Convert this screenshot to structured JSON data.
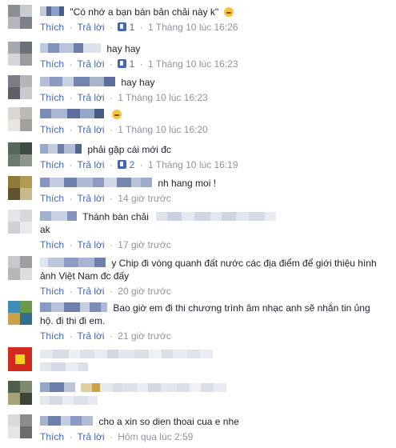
{
  "labels": {
    "like": "Thích",
    "reply": "Trả lời",
    "sep": "·"
  },
  "comments": [
    {
      "text": "\"Có nhớ a bạn bán bản chải này k\"",
      "emoji": true,
      "likes": "1",
      "time": "1 Tháng 10 lúc 16:26"
    },
    {
      "text": "hay hay",
      "likes": "1",
      "time": "1 Tháng 10 lúc 16:23"
    },
    {
      "text": "hay hay",
      "likes": "",
      "time": "1 Tháng 10 lúc 16:23"
    },
    {
      "text": "",
      "emoji": true,
      "likes": "",
      "time": "1 Tháng 10 lúc 16:20"
    },
    {
      "text": "phải gặp cái mới đc",
      "likes": "2",
      "time": "1 Tháng 10 lúc 16:19"
    },
    {
      "text": "nh hang moi !",
      "likes": "",
      "time": "14 giờ trước"
    },
    {
      "text": "Thánh bàn chải",
      "text2": "ak",
      "likes": "",
      "time": "17 giờ trước"
    },
    {
      "text": "y Chip đi vòng quanh đất nước các địa điểm để giới thiệu hình",
      "text2": "ảnh Việt Nam đc đấy",
      "likes": "",
      "time": "20 giờ trước"
    },
    {
      "text": "Bao giờ em đi thi chương trình âm nhạc anh sẽ nhắn tin ủng",
      "text2": "hộ. đi thi đi em.",
      "likes": "",
      "time": "21 giờ trước"
    },
    {
      "text": "",
      "likes": "",
      "time": ""
    },
    {
      "text": "",
      "likes": "",
      "time": ""
    },
    {
      "text": "cho a xin so dien thoai cua e nhe",
      "likes": "",
      "time": "Hôm qua lúc 2:59"
    }
  ]
}
